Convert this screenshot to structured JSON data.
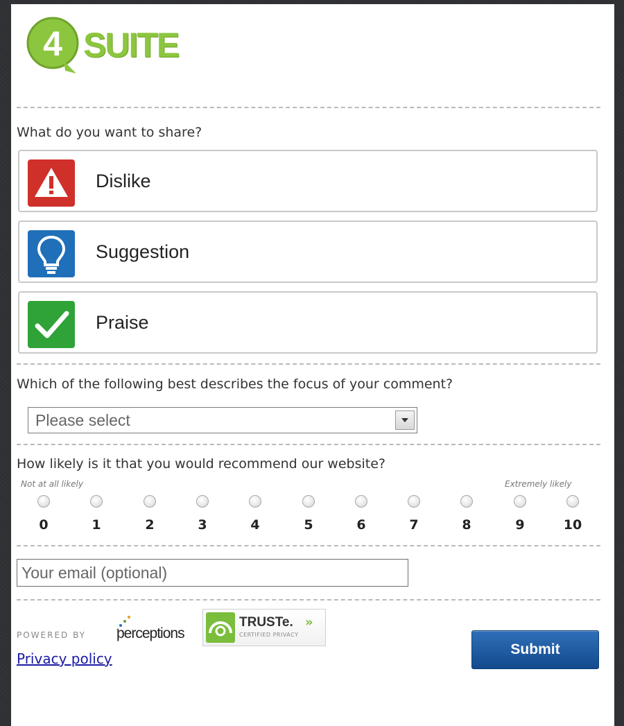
{
  "brand": {
    "logo_number": "4",
    "logo_text": "SUITE",
    "logo_color": "#8cc63f"
  },
  "share": {
    "question": "What do you want to share?",
    "options": [
      {
        "label": "Dislike",
        "icon": "warning-icon",
        "color": "#d0302a"
      },
      {
        "label": "Suggestion",
        "icon": "lightbulb-icon",
        "color": "#1f6fb9"
      },
      {
        "label": "Praise",
        "icon": "checkmark-icon",
        "color": "#2fa338"
      }
    ]
  },
  "focus": {
    "question": "Which of the following best describes the focus of your comment?",
    "selected": "Please select"
  },
  "recommend": {
    "question": "How likely is it that you would recommend our website?",
    "low_label": "Not at all likely",
    "high_label": "Extremely likely",
    "scale": [
      "0",
      "1",
      "2",
      "3",
      "4",
      "5",
      "6",
      "7",
      "8",
      "9",
      "10"
    ]
  },
  "email": {
    "placeholder": "Your email (optional)"
  },
  "footer": {
    "powered_by": "POWERED BY",
    "provider": "perceptions",
    "seal_name": "TRUSTe.",
    "seal_sub": "CERTIFIED PRIVACY",
    "privacy_link": "Privacy policy",
    "submit_label": "Submit"
  }
}
